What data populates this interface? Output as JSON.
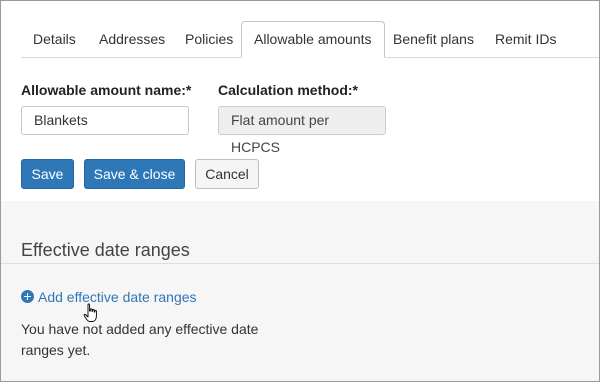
{
  "tabs": [
    {
      "label": "Details",
      "active": false
    },
    {
      "label": "Addresses",
      "active": false
    },
    {
      "label": "Policies",
      "active": false
    },
    {
      "label": "Allowable amounts",
      "active": true
    },
    {
      "label": "Benefit plans",
      "active": false
    },
    {
      "label": "Remit IDs",
      "active": false
    }
  ],
  "form": {
    "name_label": "Allowable amount name:*",
    "name_value": "Blankets",
    "method_label": "Calculation method:*",
    "method_value": "Flat amount per HCPCS"
  },
  "buttons": {
    "save": "Save",
    "save_close": "Save & close",
    "cancel": "Cancel"
  },
  "effective": {
    "title": "Effective date ranges",
    "add_link": "Add effective date ranges",
    "add_icon": "plus-circle-icon",
    "empty_message": "You have not added any effective date ranges yet."
  },
  "colors": {
    "primary": "#2f78b8",
    "link": "#2e78b7"
  }
}
